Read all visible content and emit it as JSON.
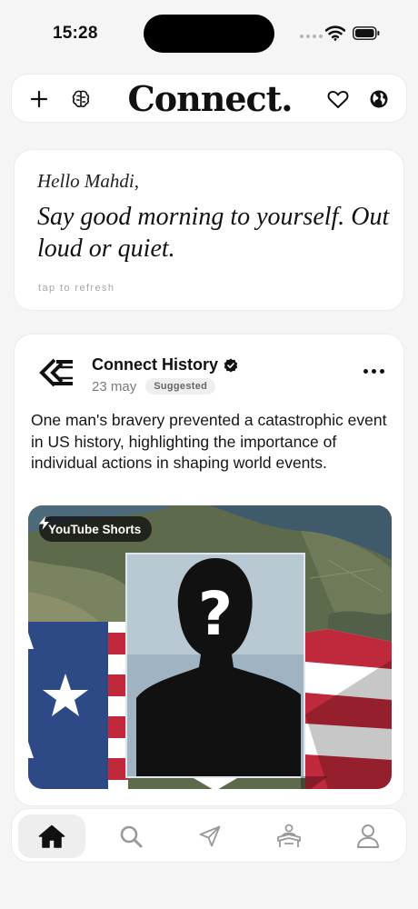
{
  "status_bar": {
    "time": "15:28"
  },
  "header": {
    "logo": "Connect.",
    "icons": [
      "plus-icon",
      "brain-icon",
      "heart-icon",
      "globe-icon"
    ]
  },
  "greeting": {
    "hello": "Hello Mahdi,",
    "message": "Say good morning to yourself. Out loud or quiet.",
    "hint": "tap to refresh"
  },
  "post": {
    "author": "Connect History",
    "date": "23 may",
    "badge": "Suggested",
    "text": "One man's bravery prevented a catastrophic event in US history, highlighting the importance of individual actions in shaping world events.",
    "media_source": "YouTube Shorts",
    "media_placeholder": "?"
  },
  "nav": {
    "items": [
      "home-icon",
      "search-icon",
      "send-icon",
      "reading-icon",
      "profile-icon"
    ],
    "active": "home"
  },
  "colors": {
    "background": "#f5f5f5",
    "card": "#ffffff",
    "text": "#111111",
    "muted": "#7a7a7a",
    "flag_red": "#c0283c",
    "flag_blue": "#2e4a86"
  }
}
